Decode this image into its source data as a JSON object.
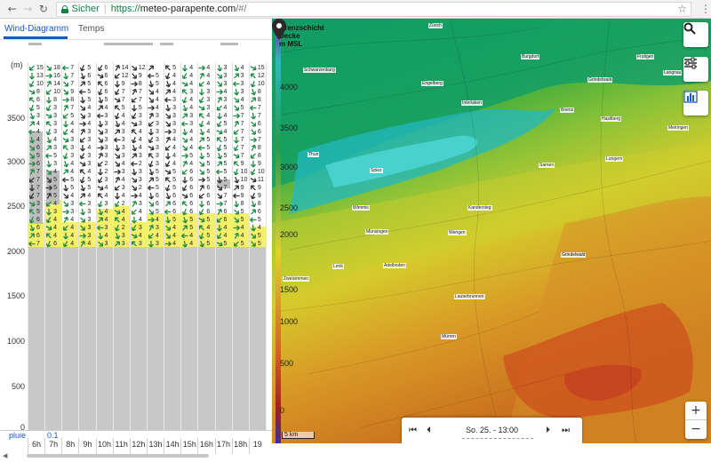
{
  "browser": {
    "secure_label": "Sicher",
    "url_scheme": "https://",
    "url_host": "meteo-parapente.com",
    "url_path": "/#/"
  },
  "left_panel": {
    "tabs": [
      {
        "label": "Wind-Diagramm",
        "active": true
      },
      {
        "label": "Temps",
        "active": false
      }
    ],
    "y_axis_title": "(m)",
    "y_ticks": [
      "0",
      "500",
      "1000",
      "1500",
      "2000",
      "2500",
      "3000",
      "3500"
    ],
    "hours": [
      "6h",
      "7h",
      "8h",
      "9h",
      "10h",
      "11h",
      "12h",
      "13h",
      "14h",
      "15h",
      "16h",
      "17h",
      "18h",
      "19"
    ],
    "rain_label": "pluie",
    "rain_value": "0.1",
    "wind_speeds": [
      [
        "15",
        "18",
        "7",
        "5",
        "6",
        "14",
        "12",
        "",
        "5",
        "4",
        "4",
        "3",
        "4",
        "15"
      ],
      [
        "13",
        "16",
        "7",
        "6",
        "6",
        "12",
        "9",
        "5",
        "4",
        "4",
        "4",
        "3",
        "3",
        "12"
      ],
      [
        "10",
        "14",
        "7",
        "5",
        "6",
        "9",
        "8",
        "5",
        "4",
        "4",
        "4",
        "3",
        "3",
        "10"
      ],
      [
        "8",
        "10",
        "9",
        "5",
        "6",
        "7",
        "7",
        "4",
        "4",
        "3",
        "3",
        "4",
        "3",
        "8"
      ],
      [
        "6",
        "8",
        "8",
        "5",
        "5",
        "7",
        "7",
        "4",
        "3",
        "4",
        "3",
        "3",
        "4",
        "8"
      ],
      [
        "5",
        "3",
        "7",
        "4",
        "4",
        "5",
        "5",
        "4",
        "3",
        "4",
        "3",
        "4",
        "5",
        "7"
      ],
      [
        "3",
        "3",
        "5",
        "3",
        "3",
        "4",
        "3",
        "3",
        "3",
        "3",
        "4",
        "4",
        "7",
        "7"
      ],
      [
        "4",
        "3",
        "4",
        "4",
        "3",
        "4",
        "3",
        "3",
        "3",
        "3",
        "4",
        "5",
        "7",
        "6"
      ],
      [
        "4",
        "3",
        "4",
        "3",
        "3",
        "3",
        "4",
        "3",
        "3",
        "4",
        "4",
        "4",
        "7",
        "6"
      ],
      [
        "4",
        "4",
        "3",
        "3",
        "3",
        "3",
        "4",
        "3",
        "4",
        "4",
        "5",
        "5",
        "7",
        "7"
      ],
      [
        "6",
        "3",
        "3",
        "4",
        "3",
        "3",
        "4",
        "3",
        "4",
        "4",
        "5",
        "5",
        "7",
        "8"
      ],
      [
        "5",
        "5",
        "3",
        "3",
        "3",
        "3",
        "3",
        "3",
        "4",
        "5",
        "5",
        "5",
        "7",
        "8"
      ],
      [
        "6",
        "3",
        "4",
        "3",
        "2",
        "4",
        "2",
        "3",
        "4",
        "4",
        "5",
        "5",
        "9",
        "9"
      ],
      [
        "7",
        "4",
        "4",
        "4",
        "2",
        "3",
        "3",
        "5",
        "5",
        "6",
        "5",
        "5",
        "10",
        "10"
      ],
      [
        "7",
        "5",
        "5",
        "5",
        "3",
        "4",
        "3",
        "5",
        "5",
        "6",
        "5",
        "5",
        "10",
        "11"
      ],
      [
        "7",
        "5",
        "5",
        "5",
        "4",
        "3",
        "2",
        "5",
        "5",
        "6",
        "6",
        "7",
        "9",
        "9"
      ],
      [
        "7",
        "5",
        "4",
        "4",
        "4",
        "4",
        "4",
        "6",
        "6",
        "6",
        "6",
        "7",
        "9",
        "9"
      ],
      [
        "3",
        "4",
        "3",
        "3",
        "3",
        "2",
        "3",
        "6",
        "6",
        "6",
        "6",
        "7",
        "8",
        "8"
      ],
      [
        "5",
        "3",
        "3",
        "3",
        "4",
        "4",
        "4",
        "5",
        "6",
        "6",
        "6",
        "6",
        "5",
        "6"
      ],
      [
        "6",
        "4",
        "4",
        "3",
        "4",
        "4",
        "4",
        "4",
        "5",
        "5",
        "5",
        "6",
        "5",
        "5"
      ],
      [
        "6",
        "4",
        "4",
        "3",
        "3",
        "2",
        "3",
        "3",
        "4",
        "5",
        "4",
        "4",
        "4",
        "4"
      ],
      [
        "6",
        "4",
        "4",
        "3",
        "4",
        "3",
        "4",
        "4",
        "4",
        "4",
        "5",
        "4",
        "4",
        "5"
      ],
      [
        "7",
        "6",
        "4",
        "4",
        "3",
        "3",
        "3",
        "3",
        "4",
        "4",
        "5",
        "5",
        "5",
        "5"
      ]
    ]
  },
  "map": {
    "title_lines": [
      "Grenzschicht",
      "Decke",
      "m MSL"
    ],
    "altitude_labels": [
      "4000",
      "3500",
      "3000",
      "2500",
      "2000",
      "1500",
      "1000",
      "500",
      "0"
    ],
    "towns": [
      {
        "name": "Zürich"
      },
      {
        "name": "Frutigen"
      },
      {
        "name": "Grindelwald"
      },
      {
        "name": "Interlaken"
      },
      {
        "name": "Thun"
      },
      {
        "name": "Brienz"
      },
      {
        "name": "Spiez"
      },
      {
        "name": "Meiringen"
      },
      {
        "name": "Wengen"
      },
      {
        "name": "Mürren"
      },
      {
        "name": "Lenk"
      },
      {
        "name": "Zweisimmen"
      },
      {
        "name": "Adelboden"
      },
      {
        "name": "Kandersteg"
      },
      {
        "name": "Lauterbrunnen"
      },
      {
        "name": "Engelberg"
      },
      {
        "name": "Sarnen"
      },
      {
        "name": "Lungern"
      },
      {
        "name": "Schwarzenburg"
      },
      {
        "name": "Burgdorf"
      },
      {
        "name": "Langnau"
      },
      {
        "name": "Münsingen"
      },
      {
        "name": "Wimmis"
      },
      {
        "name": "Hasliberg"
      }
    ],
    "pin_label": "Grindelwald",
    "scale_label": "5 km",
    "time_label": "So. 25. - 13:00",
    "colors": {
      "low": "#b5441f",
      "mid": "#e4d02e",
      "high": "#1f9e4a",
      "top": "#1bc4c8"
    }
  }
}
